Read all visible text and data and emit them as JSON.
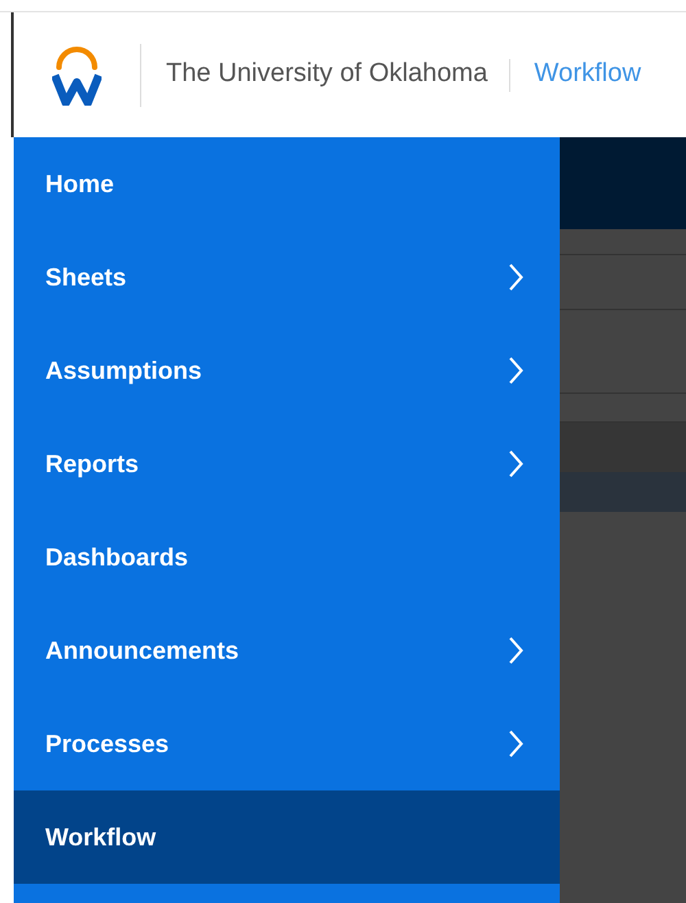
{
  "header": {
    "organization": "The University of Oklahoma",
    "current_page": "Workflow"
  },
  "menu": [
    {
      "label": "Home",
      "has_submenu": false,
      "selected": false
    },
    {
      "label": "Sheets",
      "has_submenu": true,
      "selected": false
    },
    {
      "label": "Assumptions",
      "has_submenu": true,
      "selected": false
    },
    {
      "label": "Reports",
      "has_submenu": true,
      "selected": false
    },
    {
      "label": "Dashboards",
      "has_submenu": false,
      "selected": false
    },
    {
      "label": "Announcements",
      "has_submenu": true,
      "selected": false
    },
    {
      "label": "Processes",
      "has_submenu": true,
      "selected": false
    },
    {
      "label": "Workflow",
      "has_submenu": false,
      "selected": true
    }
  ]
}
